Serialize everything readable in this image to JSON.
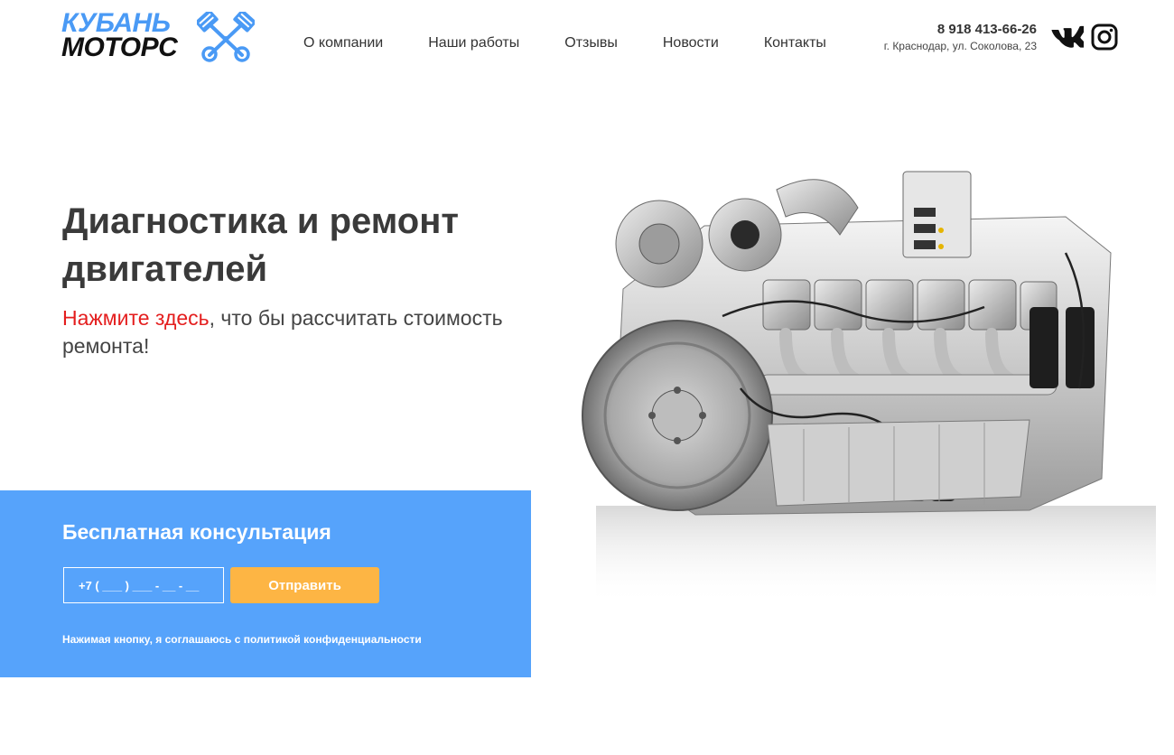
{
  "header": {
    "logo": {
      "line1": "КУБАНЬ",
      "line2": "МОТОРС",
      "icon": "crossed-pistons-icon"
    },
    "nav": [
      {
        "label": "О компании"
      },
      {
        "label": "Наши работы"
      },
      {
        "label": "Отзывы"
      },
      {
        "label": "Новости"
      },
      {
        "label": "Контакты"
      }
    ],
    "phone": "8 918 413-66-26",
    "address": "г. Краснодар, ул. Соколова, 23",
    "social": {
      "vk_icon": "vk-icon",
      "instagram_icon": "instagram-icon"
    }
  },
  "hero": {
    "title": "Диагностика и ремонт двигателей",
    "subtitle_link": "Нажмите здесь",
    "subtitle_rest": ", что бы рассчитать стоимость ремонта!",
    "image": "engine-image"
  },
  "consultation": {
    "title": "Бесплатная консультация",
    "phone_placeholder": "+7 ( ___ ) ___ - __ - __",
    "submit_label": "Отправить",
    "policy": "Нажимая кнопку, я соглашаюсь с политикой конфиденциальности"
  },
  "colors": {
    "brand_blue": "#4a9af5",
    "form_background": "#56a3fb",
    "button": "#fdb544",
    "link_red": "#e41e1e",
    "text": "#333333"
  }
}
